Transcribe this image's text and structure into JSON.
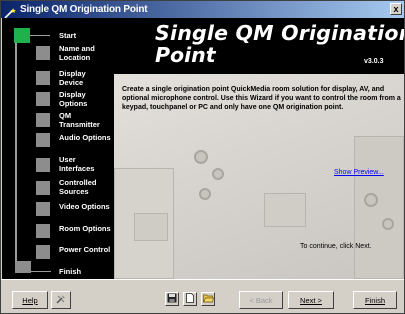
{
  "window": {
    "title": "Single QM Origination Point",
    "close_label": "x"
  },
  "sidebar": {
    "start_label": "Start",
    "finish_label": "Finish",
    "steps": [
      "Name and Location",
      "Display Device",
      "Display Options",
      "QM Transmitter",
      "Audio Options",
      "User Interfaces",
      "Controlled Sources",
      "Video Options",
      "Room Options",
      "Power Control"
    ]
  },
  "content": {
    "title_line1": "Single QM Origination",
    "title_line2": "Point",
    "version": "v3.0.3",
    "description": "Create a single origination point QuickMedia room solution for display, AV, and optional microphone control. Use this Wizard if you want to control the room from a keypad, touchpanel or PC and only have one QM origination point.",
    "preview_link": "Show Preview...",
    "continue_text": "To continue, click Next."
  },
  "buttons": {
    "help": "Help",
    "back": "< Back",
    "next": "Next >",
    "finish": "Finish"
  },
  "colors": {
    "titlebar_start": "#0a246a",
    "start_block": "#1fb14b",
    "link": "#0000ff"
  }
}
